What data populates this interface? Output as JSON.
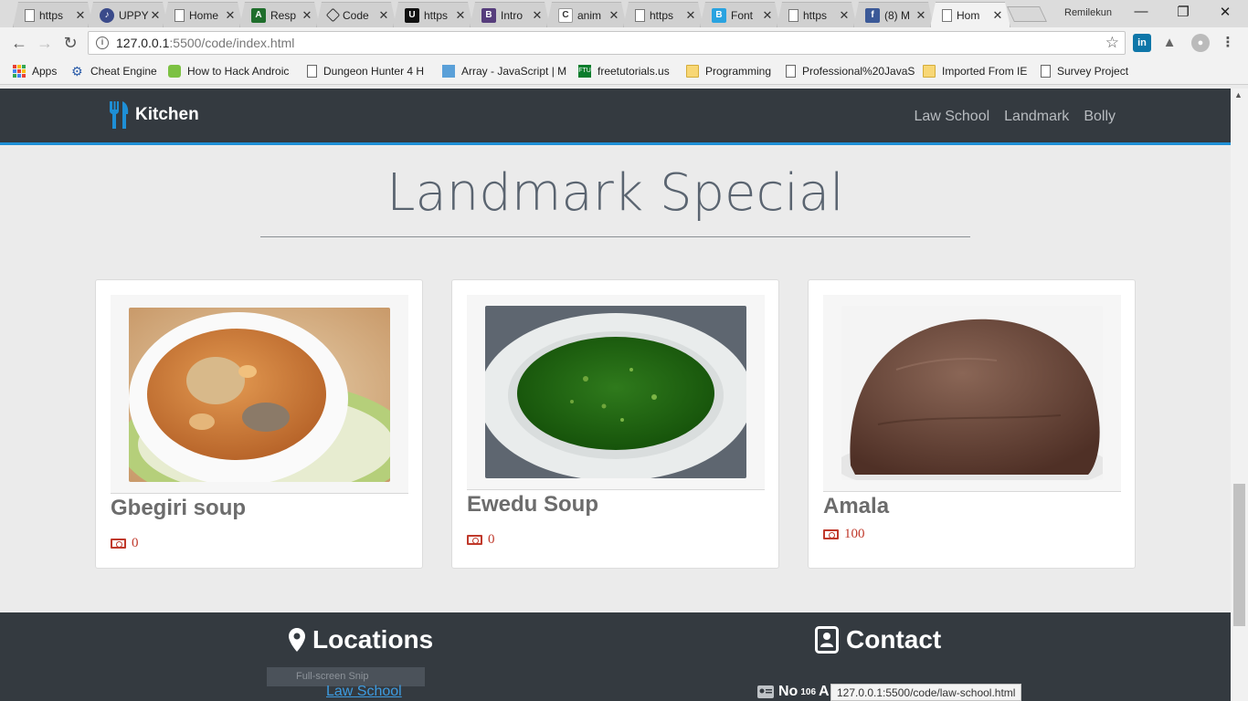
{
  "browser": {
    "tabs": [
      {
        "title": "https",
        "icon": "page-icon"
      },
      {
        "title": "UPPY",
        "icon": "uppy-icon"
      },
      {
        "title": "Home",
        "icon": "page-icon"
      },
      {
        "title": "Resp",
        "icon": "responsive-icon"
      },
      {
        "title": "Code",
        "icon": "codepen-icon"
      },
      {
        "title": "https",
        "icon": "u-icon"
      },
      {
        "title": "Intro",
        "icon": "bootstrap-icon"
      },
      {
        "title": "anim",
        "icon": "c-icon"
      },
      {
        "title": "https",
        "icon": "page-icon"
      },
      {
        "title": "Font",
        "icon": "b-icon"
      },
      {
        "title": "https",
        "icon": "page-icon"
      },
      {
        "title": "(8) M",
        "icon": "facebook-icon"
      },
      {
        "title": "Hom",
        "icon": "page-icon"
      }
    ],
    "profile_name": "Remilekun",
    "url_host": "127.0.0.1",
    "url_path": ":5500/code/index.html",
    "bookmarks": [
      "Apps",
      "Cheat Engine",
      "How to Hack Androic",
      "Dungeon Hunter 4 H",
      "Array - JavaScript | M",
      "freetutorials.us",
      "Programming",
      "Professional%20JavaS",
      "Imported From IE",
      "Survey Project"
    ],
    "status_url": "127.0.0.1:5500/code/law-school.html"
  },
  "site": {
    "brand": "Kitchen",
    "nav": [
      "Law School",
      "Landmark",
      "Bolly"
    ],
    "heading": "Landmark Special",
    "cards": [
      {
        "name": "Gbegiri soup",
        "price": "0"
      },
      {
        "name": "Ewedu Soup",
        "price": "0"
      },
      {
        "name": "Amala",
        "price": "100"
      }
    ],
    "footer": {
      "locations_heading": "Locations",
      "snip_label": "Full-screen Snip",
      "location_link": "Law School",
      "contact_heading": "Contact",
      "contact_line_prefix": "No",
      "contact_line_sup": "106",
      "contact_line_rest": "A"
    }
  },
  "colors": {
    "nav_bg": "#343a40",
    "accent_blue": "#1e8fd6",
    "price_red": "#c0392b"
  }
}
